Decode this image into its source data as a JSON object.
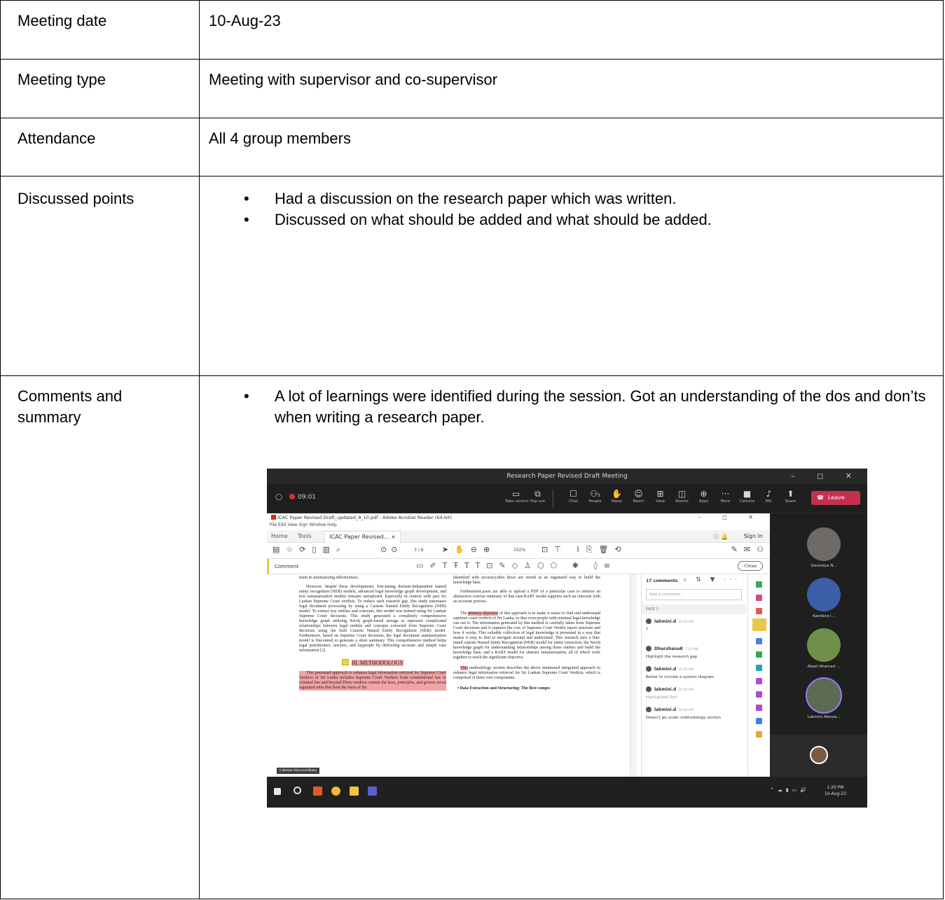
{
  "rows": {
    "date": {
      "label": "Meeting date",
      "value": "10-Aug-23"
    },
    "type": {
      "label": "Meeting type",
      "value": "Meeting with supervisor and co-supervisor"
    },
    "attendance": {
      "label": "Attendance",
      "value": "All 4 group members"
    },
    "discussed": {
      "label": "Discussed points",
      "items": [
        "Had a discussion on the research paper which was written.",
        "Discussed on what should be added and what should be added."
      ]
    },
    "comments": {
      "label_line1": "Comments and",
      "label_line2": "summary",
      "items": [
        "A lot of learnings were identified during the session. Got an understanding of the dos and don’ts when writing a research paper."
      ]
    }
  },
  "screenshot": {
    "window_title": "Research Paper Revised Draft Meeting",
    "timer": "09:01",
    "toolbar": [
      {
        "icon": "take-control-icon",
        "label": "Take control"
      },
      {
        "icon": "pop-out-icon",
        "label": "Pop out"
      },
      {
        "icon": "chat-icon",
        "label": "Chat"
      },
      {
        "icon": "people-icon",
        "label": "People"
      },
      {
        "icon": "raise-hand-icon",
        "label": "Raise"
      },
      {
        "icon": "react-icon",
        "label": "React"
      },
      {
        "icon": "view-icon",
        "label": "View"
      },
      {
        "icon": "rooms-icon",
        "label": "Rooms"
      },
      {
        "icon": "apps-icon",
        "label": "Apps"
      },
      {
        "icon": "more-icon",
        "label": "More"
      },
      {
        "icon": "camera-icon",
        "label": "Camera"
      },
      {
        "icon": "mic-icon",
        "label": "Mic"
      },
      {
        "icon": "share-icon",
        "label": "Share"
      }
    ],
    "people_count": "5",
    "leave_label": "Leave",
    "acrobat": {
      "title": "ICAC Paper Revised Draft_updated_8_10.pdf - Adobe Acrobat Reader (64-bit)",
      "menu": "File  Edit  View  Sign  Window  Help",
      "tab_home": "Home",
      "tab_tools": "Tools",
      "tab_doc": "ICAC Paper Revised... ×",
      "sign_in": "Sign In",
      "page_indicator": "3  / 6",
      "zoom": "102%",
      "comment_label": "Comment",
      "close_label": "Close",
      "comments_count": "17 comments",
      "add_comment_placeholder": "Add a comment...",
      "page_label": "PAGE 3",
      "comments": [
        {
          "author": "lakmini.d",
          "time": "10:34 AM",
          "text": "?"
        },
        {
          "author": "DharshanaK",
          "time": "7:53 AM",
          "text": "Highlight the research gap"
        },
        {
          "author": "lakmini.d",
          "time": "10:45 AM",
          "text": "Better to include a system diagram"
        },
        {
          "author": "lakmini.d",
          "time": "10:35 AM",
          "text": "Highlighted Text"
        },
        {
          "author": "lakmini.d",
          "time": "10:42 AM",
          "text": "Doesn't go under methodology section"
        }
      ],
      "col1_p1": "ment in summarizing effectiveness.",
      "col1_p2": "However, despite these developments, fine-tuning domain-independent named entity recognition (NER) models, advanced legal knowledge graph development, and text summarization models remains unexplored. Especially in context with past Sri Lankan Supreme Court verdicts. To reduce such research gap, this study automates legal document processing by using a Custom Named Entity Recognition (NER) model. To extract key entities and concepts, this model was trained using Sri Lankan Supreme Court decisions. This study generated a completely comprehensive knowledge graph utilizing Neo4j graph-based storage to represent complicated relationships between legal entities and concepts extracted from Supreme Court decisions using the built Custom Named Entity Recognition (NER) model. Furthermore, based on Supreme Court decisions, the legal document summarization model is fine-tuned to generate a short summary. This comprehensive method helps legal practitioners, lawyers, and laypeople by delivering accurate and simple case information [3].",
      "section_heading": "III. METHODOLOGY",
      "col1_p3": "This presented approach to enhance legal information retrieval for Supreme Court Verdicts of Sri Lanka includes Supreme Court Verdicts from constitutional law to criminal law and beyond.These verdicts contain the laws, principles, and govern social regulated rules that form the basis of Sri",
      "col2_p1": "identified with accuracy,then those are stored in an organized way to build the knowledge base.",
      "col2_p2": "Furthermore,users are able to upload a PDF of a particular case to retrieve an abstractive concise summary of that case.BART model supports such an outcome with an accurate process.",
      "col2_p3_hl": "primary objective",
      "col2_p3_pre": "The ",
      "col2_p3_post": " of this approach is to make it easier to find and understand supreme court verdicts of Sri Lanka, so that even people with minimal legal knowledge can use it. The information generated by this method is carefully taken from Supreme Court decisions and it captures the core of Supreme Court Verdict report structure and how it works. This valuable collection of legal knowledge is presented in a way that makes it easy to find to navigate around and understand. This research uses a fine-tuned custom Named Entity Recognition (NER) model for entity extraction, the Neo4j knowledge graph for understanding relationships among those entities and build the knowledge base, and a BART model for abstract summarization, all of which work together to reach the significant objective.",
      "col2_p4_hl": "This",
      "col2_p4_post": " methodology section describes the above mentioned integrated approach to enhance legal information retrieval for Sri Lankan Supreme Court Verdicts, which is comprised of three core components.",
      "col2_p5": "• Data Extraction and Structuring: The first compo-"
    },
    "participants": [
      {
        "name": "Gavindya N...",
        "color": "#6f6a66"
      },
      {
        "name": "Kandara I...",
        "color": "#3a5ea8"
      },
      {
        "name": "Akeel Ahamed ...",
        "color": "#6f8f4a"
      },
      {
        "name": "Lakmini Abeyw...",
        "color": "#5c6b52"
      }
    ],
    "presenter_tag": "Lakmini Abeywardhana",
    "clock_time": "1:20 PM",
    "clock_date": "10-Aug-23"
  }
}
